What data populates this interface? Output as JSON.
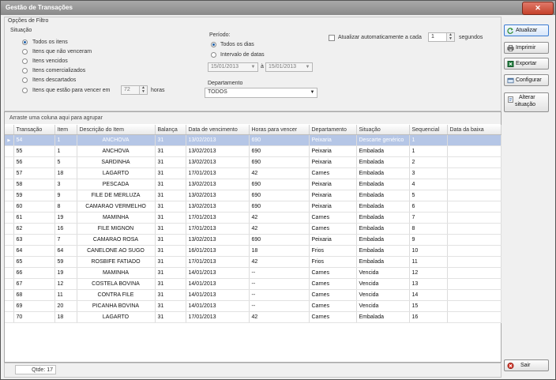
{
  "window": {
    "title": "Gestão de Transações"
  },
  "filter": {
    "group_title": "Opções de Filtro",
    "situacao": {
      "label": "Situação",
      "options": [
        "Todos os itens",
        "Itens que não venceram",
        "Itens vencidos",
        "Itens comercializados",
        "Itens descartados",
        "Itens que estão para vencer em"
      ],
      "selected": "Todos os itens",
      "hours_value": "72",
      "hours_suffix": "horas"
    },
    "periodo": {
      "label": "Período:",
      "options": [
        "Todos os dias",
        "Intervalo de datas"
      ],
      "selected": "Todos os dias",
      "date_from": "15/01/2013",
      "date_sep": "à",
      "date_to": "15/01/2013"
    },
    "departamento": {
      "label": "Departamento",
      "value": "TODOS"
    },
    "auto_update": {
      "label": "Atualizar automaticamente a cada",
      "value": "1",
      "suffix": "segundos",
      "checked": false
    }
  },
  "buttons": {
    "atualizar": "Atualizar",
    "imprimir": "Imprimir",
    "exportar": "Exportar",
    "configurar": "Configurar",
    "alterar": [
      "Alterar",
      "situação"
    ],
    "sair": "Sair"
  },
  "grid": {
    "group_hint": "Arraste uma coluna aqui para agrupar",
    "columns": [
      "Transação",
      "Item",
      "Descrição do Item",
      "Balança",
      "Data de vencimento",
      "Horas para vencer",
      "Departamento",
      "Situação",
      "Sequencial",
      "Data da baixa"
    ],
    "rows": [
      [
        "54",
        "1",
        "ANCHOVA",
        "31",
        "13/02/2013",
        "690",
        "Peixaria",
        "Descarte genérico",
        "1",
        ""
      ],
      [
        "55",
        "1",
        "ANCHOVA",
        "31",
        "13/02/2013",
        "690",
        "Peixaria",
        "Embalada",
        "1",
        ""
      ],
      [
        "56",
        "5",
        "SARDINHA",
        "31",
        "13/02/2013",
        "690",
        "Peixaria",
        "Embalada",
        "2",
        ""
      ],
      [
        "57",
        "18",
        "LAGARTO",
        "31",
        "17/01/2013",
        "42",
        "Carnes",
        "Embalada",
        "3",
        ""
      ],
      [
        "58",
        "3",
        "PESCADA",
        "31",
        "13/02/2013",
        "690",
        "Peixaria",
        "Embalada",
        "4",
        ""
      ],
      [
        "59",
        "9",
        "FILE DE MERLUZA",
        "31",
        "13/02/2013",
        "690",
        "Peixaria",
        "Embalada",
        "5",
        ""
      ],
      [
        "60",
        "8",
        "CAMARAO VERMELHO",
        "31",
        "13/02/2013",
        "690",
        "Peixaria",
        "Embalada",
        "6",
        ""
      ],
      [
        "61",
        "19",
        "MAMINHA",
        "31",
        "17/01/2013",
        "42",
        "Carnes",
        "Embalada",
        "7",
        ""
      ],
      [
        "62",
        "16",
        "FILE MIGNON",
        "31",
        "17/01/2013",
        "42",
        "Carnes",
        "Embalada",
        "8",
        ""
      ],
      [
        "63",
        "7",
        "CAMARAO ROSA",
        "31",
        "13/02/2013",
        "690",
        "Peixaria",
        "Embalada",
        "9",
        ""
      ],
      [
        "64",
        "64",
        "CANELONE AO SUGO",
        "31",
        "16/01/2013",
        "18",
        "Frios",
        "Embalada",
        "10",
        ""
      ],
      [
        "65",
        "59",
        "ROSBIFE FATIADO",
        "31",
        "17/01/2013",
        "42",
        "Frios",
        "Embalada",
        "11",
        ""
      ],
      [
        "66",
        "19",
        "MAMINHA",
        "31",
        "14/01/2013",
        "--",
        "Carnes",
        "Vencida",
        "12",
        ""
      ],
      [
        "67",
        "12",
        "COSTELA BOVINA",
        "31",
        "14/01/2013",
        "--",
        "Carnes",
        "Vencida",
        "13",
        ""
      ],
      [
        "68",
        "11",
        "CONTRA FILE",
        "31",
        "14/01/2013",
        "--",
        "Carnes",
        "Vencida",
        "14",
        ""
      ],
      [
        "69",
        "20",
        "PICANHA BOVINA",
        "31",
        "14/01/2013",
        "--",
        "Carnes",
        "Vencida",
        "15",
        ""
      ],
      [
        "70",
        "18",
        "LAGARTO",
        "31",
        "17/01/2013",
        "42",
        "Carnes",
        "Embalada",
        "16",
        ""
      ]
    ],
    "selected_row": 0
  },
  "status": {
    "count_label": "Qtde: 17"
  },
  "colors": {
    "selection": "#b5c6e6",
    "accent": "#1e5fa8",
    "titlebar": "#8a8a8a"
  }
}
